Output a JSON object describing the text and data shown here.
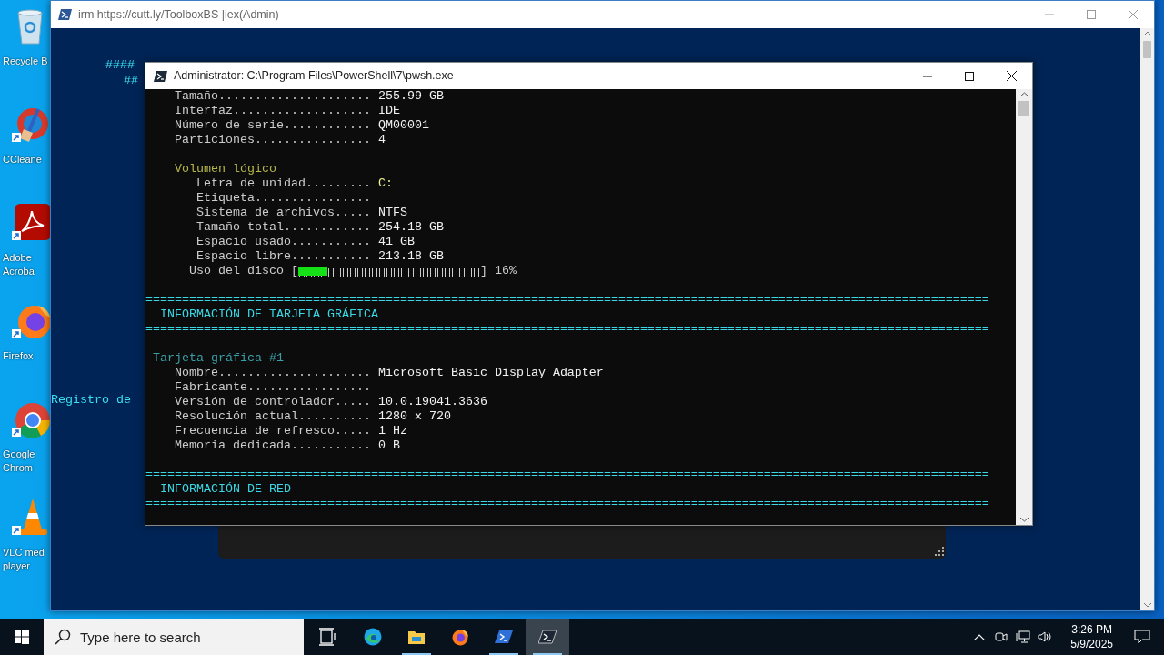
{
  "desktop_icons": [
    {
      "kind": "recycle",
      "lines": [
        "Recycle B"
      ]
    },
    {
      "kind": "cleaner",
      "lines": [
        "CCleane"
      ]
    },
    {
      "kind": "pdf",
      "lines": [
        "Adobe",
        "Acroba"
      ]
    },
    {
      "kind": "firefox",
      "lines": [
        "Firefox"
      ]
    },
    {
      "kind": "chrome",
      "lines": [
        "Google",
        "Chrom"
      ]
    },
    {
      "kind": "vlc",
      "lines": [
        "VLC med",
        "player"
      ]
    }
  ],
  "back_window": {
    "title": "irm https://cutt.ly/ToolboxBS |iex(Admin)",
    "lines": [
      "####",
      "##"
    ],
    "footer_text": "Registro de"
  },
  "front_window": {
    "title": "Administrator: C:\\Program Files\\PowerShell\\7\\pwsh.exe",
    "lines": [
      {
        "kind": "field",
        "label": "Tamaño.....................",
        "value": "255.99 GB",
        "color": "#f2f2f2"
      },
      {
        "kind": "field",
        "label": "Interfaz...................",
        "value": "IDE",
        "color": "#f2f2f2"
      },
      {
        "kind": "field",
        "label": "Número de serie............",
        "value": "QM00001",
        "color": "#f2f2f2"
      },
      {
        "kind": "field",
        "label": "Particiones................",
        "value": "4",
        "color": "#f2f2f2"
      },
      {
        "kind": "blank"
      },
      {
        "kind": "group",
        "text": "Volumen lógico"
      },
      {
        "kind": "subfield",
        "label": "Letra de unidad.........",
        "value": "C:",
        "color": "#f0ef8c"
      },
      {
        "kind": "subfield",
        "label": "Etiqueta................"
      },
      {
        "kind": "subfield",
        "label": "Sistema de archivos.....",
        "value": "NTFS",
        "color": "#f2f2f2"
      },
      {
        "kind": "subfield",
        "label": "Tamaño total............",
        "value": "254.18 GB",
        "color": "#f2f2f2"
      },
      {
        "kind": "subfield",
        "label": "Espacio usado...........",
        "value": "41 GB",
        "color": "#f2f2f2"
      },
      {
        "kind": "subfield",
        "label": "Espacio libre...........",
        "value": "213.18 GB",
        "color": "#f2f2f2"
      },
      {
        "kind": "progress",
        "label": "Uso del disco",
        "open": "[",
        "close": "]",
        "level": 0.16,
        "reading": "16%"
      },
      {
        "kind": "blank"
      },
      {
        "kind": "separator",
        "text": "===================================================================================================================="
      },
      {
        "kind": "heading",
        "text": "INFORMACIÓN DE TARJETA GRÁFICA"
      },
      {
        "kind": "separator",
        "text": "===================================================================================================================="
      },
      {
        "kind": "blank"
      },
      {
        "kind": "card_title",
        "text": "Tarjeta gráfica #1"
      },
      {
        "kind": "field",
        "label": "Nombre.....................",
        "value": "Microsoft Basic Display Adapter",
        "color": "#f2f2f2"
      },
      {
        "kind": "field",
        "label": "Fabricante................."
      },
      {
        "kind": "field",
        "label": "Versión de controlador.....",
        "value": "10.0.19041.3636",
        "color": "#f2f2f2"
      },
      {
        "kind": "field",
        "label": "Resolución actual..........",
        "value": "1280 x 720",
        "color": "#f2f2f2"
      },
      {
        "kind": "field",
        "label": "Frecuencia de refresco.....",
        "value": "1 Hz",
        "color": "#f2f2f2"
      },
      {
        "kind": "field",
        "label": "Memoria dedicada...........",
        "value": "0 B",
        "color": "#f2f2f2"
      },
      {
        "kind": "blank"
      },
      {
        "kind": "separator",
        "text": "===================================================================================================================="
      },
      {
        "kind": "heading",
        "text": "INFORMACIÓN DE RED"
      },
      {
        "kind": "separator",
        "text": "===================================================================================================================="
      }
    ]
  },
  "taskbar": {
    "search": {
      "placeholder": "Type here to search"
    },
    "apps": [
      {
        "kind": "taskview",
        "running": false,
        "selected": false
      },
      {
        "kind": "edge",
        "running": false,
        "selected": false
      },
      {
        "kind": "explorer",
        "running": true,
        "selected": false
      },
      {
        "kind": "firefox",
        "running": false,
        "selected": false
      },
      {
        "kind": "powershell",
        "running": true,
        "selected": false
      },
      {
        "kind": "terminal",
        "running": true,
        "selected": true
      }
    ],
    "time": "3:26 PM",
    "date": "5/9/2025"
  }
}
